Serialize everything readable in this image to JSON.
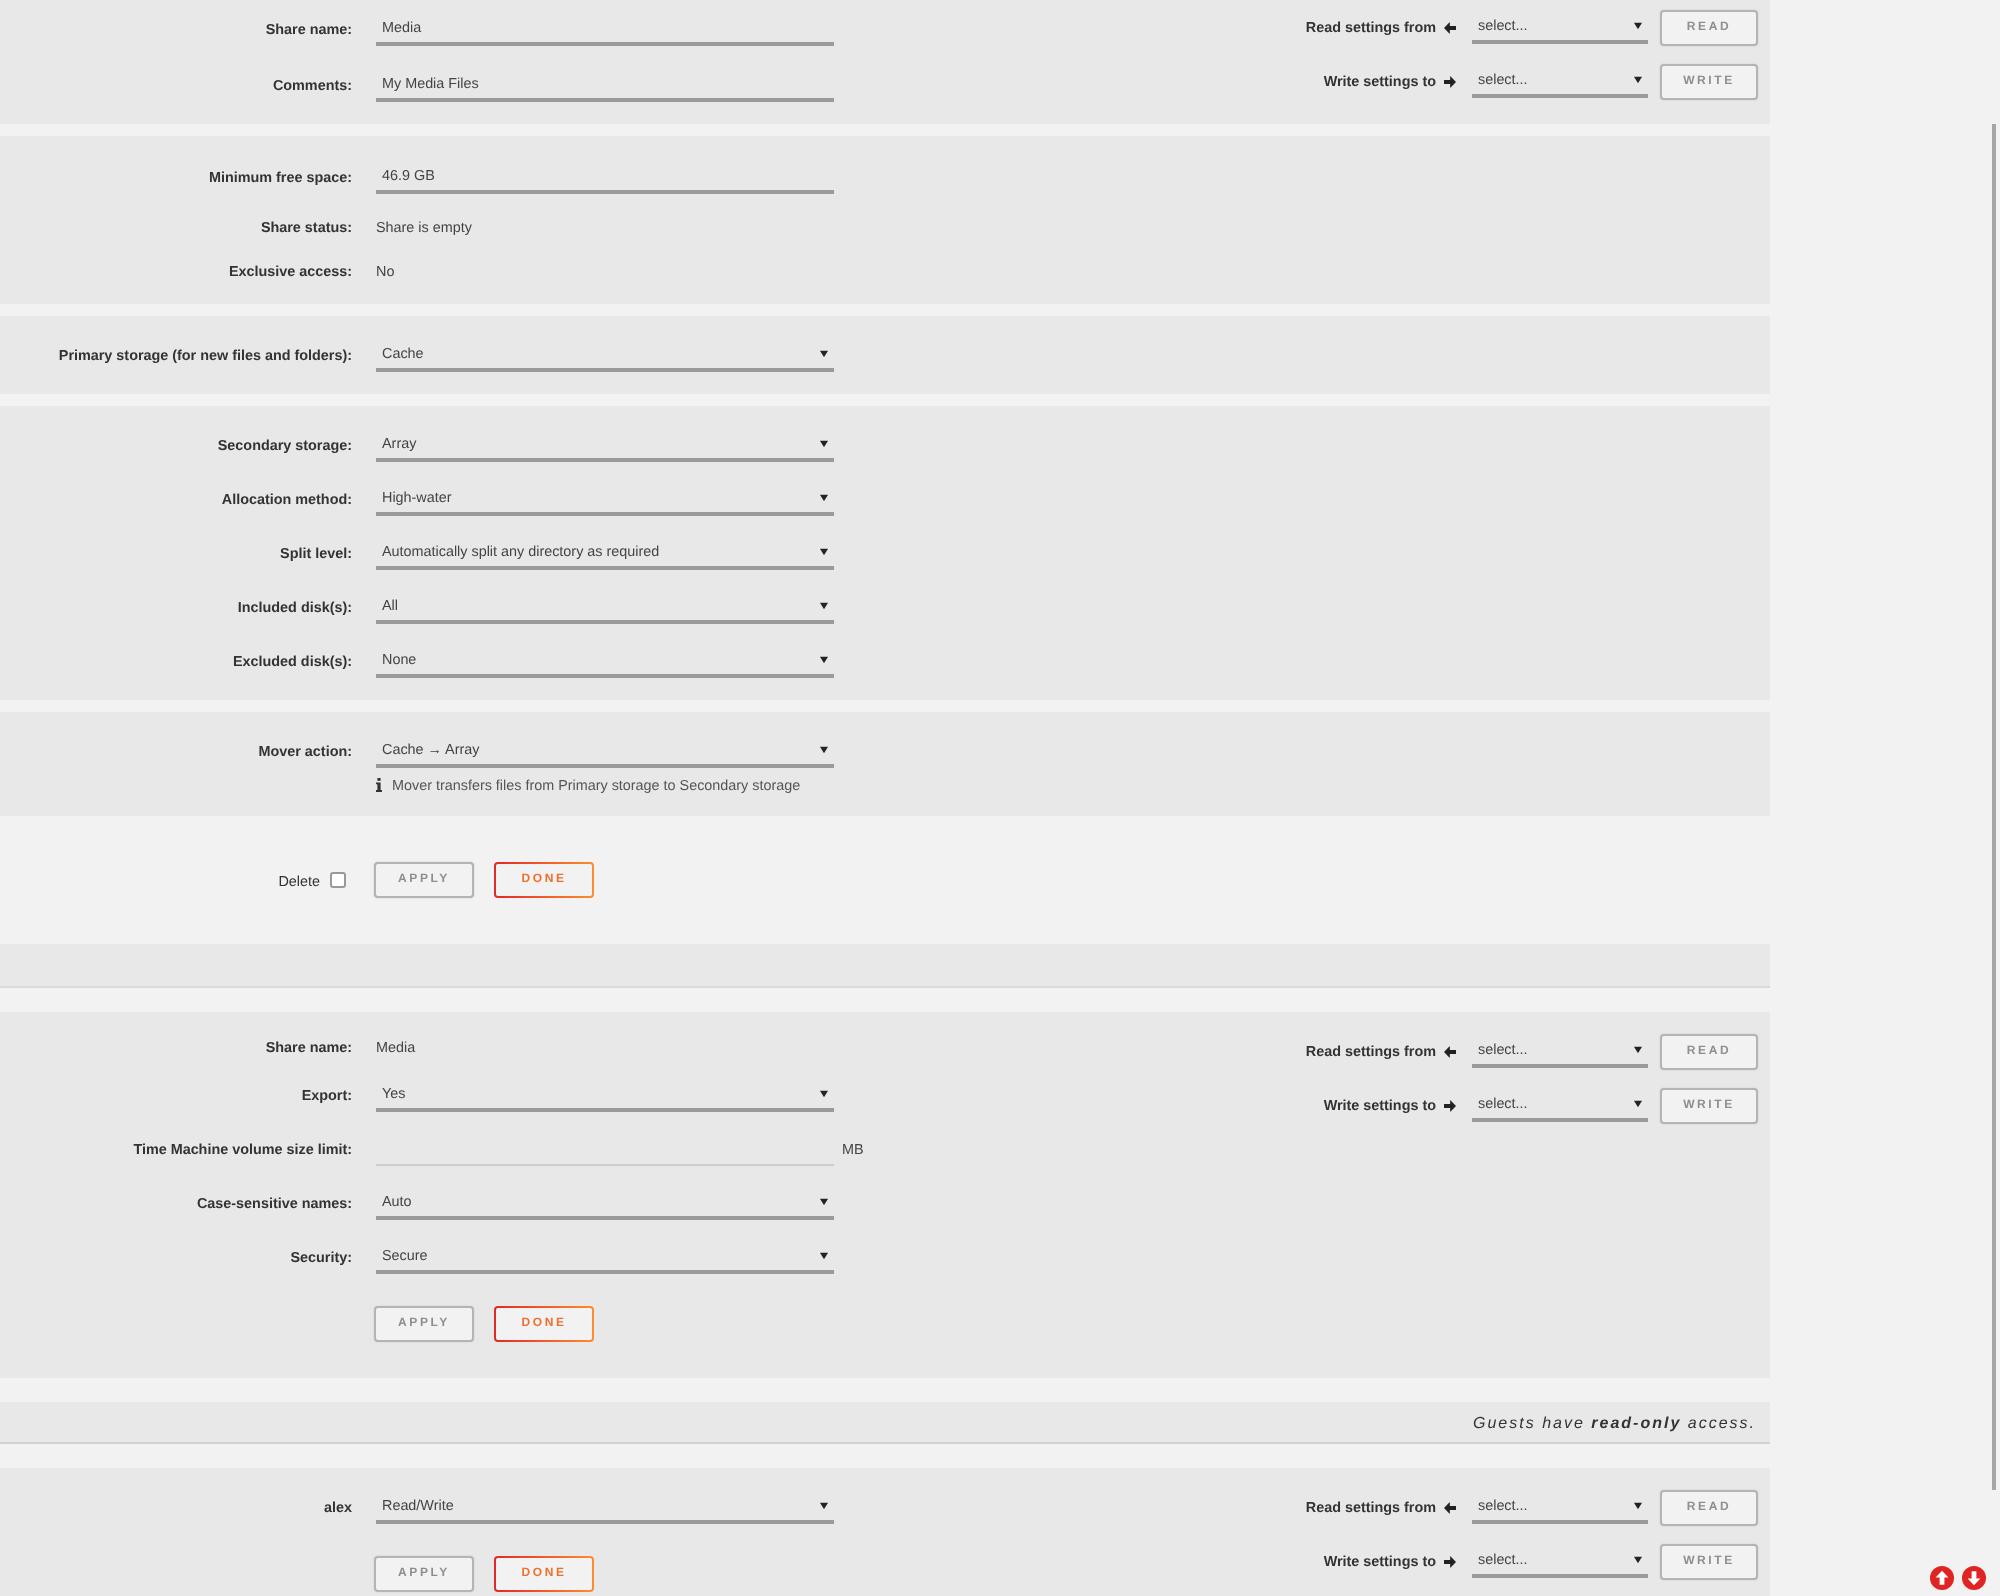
{
  "sections": [
    {
      "kind": "panel",
      "rows": [
        {
          "kind": "input",
          "label": "Share name:",
          "value": "Media"
        },
        {
          "kind": "input",
          "label": "Comments:",
          "value": "My Media Files"
        }
      ],
      "copy_settings": [
        {
          "kind": "read",
          "label": "Read settings from",
          "value": "select...",
          "button": {
            "label": "READ",
            "disabled": true
          }
        },
        {
          "kind": "write",
          "label": "Write settings to",
          "value": "select...",
          "button": {
            "label": "WRITE",
            "disabled": true
          }
        }
      ]
    },
    {
      "kind": "panel",
      "rows": [
        {
          "kind": "input",
          "label": "Minimum free space:",
          "value": "46.9 GB"
        },
        {
          "kind": "text",
          "label": "Share status:",
          "value": "Share is empty"
        },
        {
          "kind": "text",
          "label": "Exclusive access:",
          "value": "No"
        }
      ]
    },
    {
      "kind": "panel",
      "rows": [
        {
          "kind": "select",
          "label": "Primary storage (for new files and folders):",
          "value": "Cache"
        }
      ]
    },
    {
      "kind": "panel",
      "rows": [
        {
          "kind": "select",
          "label": "Secondary storage:",
          "value": "Array"
        },
        {
          "kind": "select",
          "label": "Allocation method:",
          "value": "High-water"
        },
        {
          "kind": "select",
          "label": "Split level:",
          "value": "Automatically split any directory as required"
        },
        {
          "kind": "select",
          "label": "Included disk(s):",
          "value": "All"
        },
        {
          "kind": "select",
          "label": "Excluded disk(s):",
          "value": "None"
        }
      ]
    },
    {
      "kind": "panel",
      "rows": [
        {
          "kind": "select",
          "label": "Mover action:",
          "value": "Cache → Array",
          "hint": "Mover transfers files from Primary storage to Secondary storage"
        }
      ]
    },
    {
      "kind": "plain",
      "delete": {
        "label": "Delete",
        "checked": false
      },
      "actions": [
        {
          "label": "APPLY",
          "disabled": true
        },
        {
          "label": "DONE",
          "disabled": false
        }
      ]
    },
    {
      "kind": "bar"
    },
    {
      "kind": "panel",
      "rows": [
        {
          "kind": "text",
          "label": "Share name:",
          "value": "Media"
        },
        {
          "kind": "select",
          "label": "Export:",
          "value": "Yes"
        },
        {
          "kind": "number",
          "label": "Time Machine volume size limit:",
          "unit": "MB"
        },
        {
          "kind": "select",
          "label": "Case-sensitive names:",
          "value": "Auto"
        },
        {
          "kind": "select",
          "label": "Security:",
          "value": "Secure"
        }
      ],
      "actions": [
        {
          "label": "APPLY",
          "disabled": true
        },
        {
          "label": "DONE",
          "disabled": false
        }
      ],
      "copy_settings": [
        {
          "kind": "read",
          "label": "Read settings from",
          "value": "select...",
          "button": {
            "label": "READ",
            "disabled": true
          }
        },
        {
          "kind": "write",
          "label": "Write settings to",
          "value": "select...",
          "button": {
            "label": "WRITE",
            "disabled": true
          }
        }
      ]
    },
    {
      "kind": "notice",
      "text": "Guests have **read-only** access."
    },
    {
      "kind": "panel",
      "rows": [
        {
          "kind": "select",
          "label": "alex",
          "value": "Read/Write"
        }
      ],
      "actions": [
        {
          "label": "APPLY",
          "disabled": true
        },
        {
          "label": "DONE",
          "disabled": false
        }
      ],
      "copy_settings": [
        {
          "kind": "read",
          "label": "Read settings from",
          "value": "select...",
          "button": {
            "label": "READ",
            "disabled": true
          }
        },
        {
          "kind": "write",
          "label": "Write settings to",
          "value": "select...",
          "button": {
            "label": "WRITE",
            "disabled": true
          }
        }
      ]
    }
  ]
}
